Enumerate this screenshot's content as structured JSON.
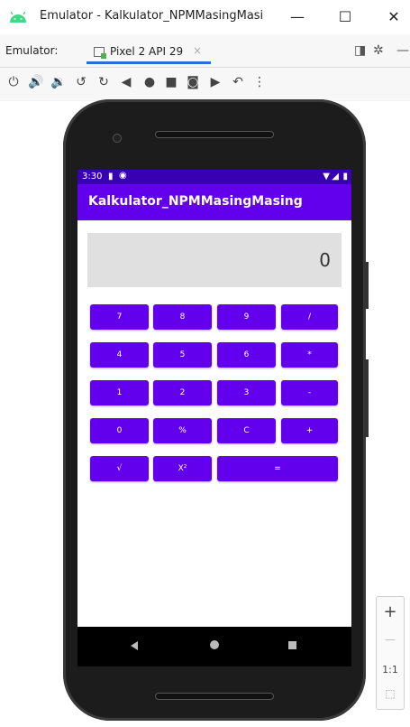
{
  "window": {
    "title": "Emulator - Kalkulator_NPMMasingMasi",
    "minimize": "—",
    "maximize": "☐",
    "close": "✕"
  },
  "toolbar": {
    "emulator_label": "Emulator:",
    "tab_label": "Pixel 2 API 29",
    "tab_close": "×"
  },
  "device": {
    "status_time": "3:30",
    "app_title": "Kalkulator_NPMMasingMasing",
    "display_value": "0"
  },
  "keypad": {
    "row1": [
      "7",
      "8",
      "9",
      "/"
    ],
    "row2": [
      "4",
      "5",
      "6",
      "*"
    ],
    "row3": [
      "1",
      "2",
      "3",
      "-"
    ],
    "row4": [
      "0",
      "%",
      "C",
      "+"
    ],
    "row5": [
      "√",
      "X²",
      "="
    ]
  },
  "zoom": {
    "plus": "+",
    "minus": "—",
    "ratio": "1:1"
  },
  "colors": {
    "primary": "#6200ee",
    "status_bar": "#3700b3",
    "display_bg": "#e0e0e0",
    "tab_accent": "#2a6ed3",
    "android_green": "#3ddc84"
  }
}
